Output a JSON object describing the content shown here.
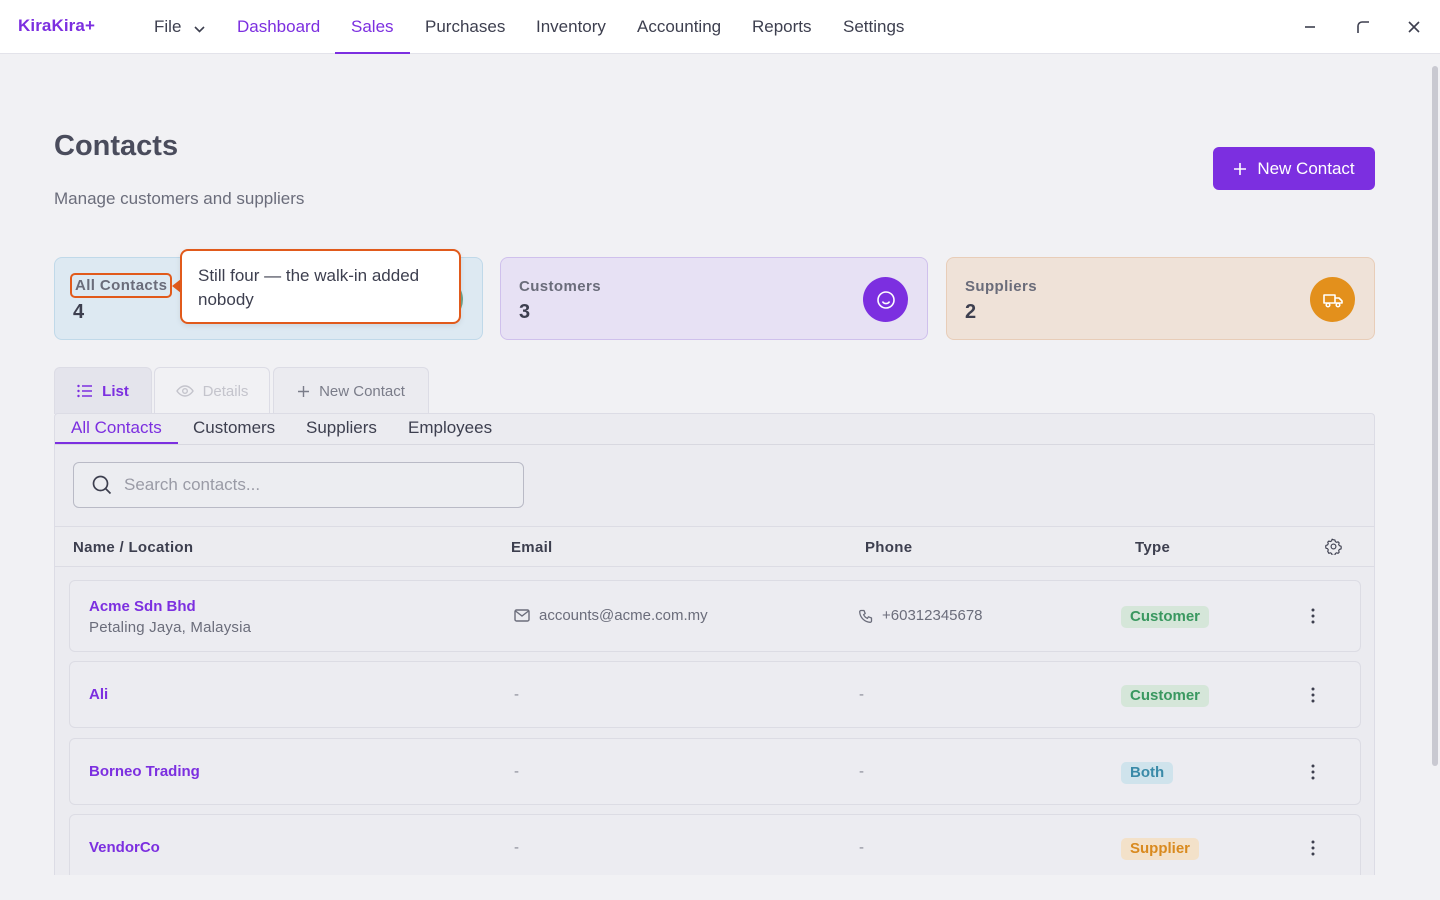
{
  "app": {
    "brand": "KiraKira+",
    "menu": [
      "File",
      "Dashboard",
      "Sales",
      "Purchases",
      "Inventory",
      "Accounting",
      "Reports",
      "Settings"
    ],
    "active_menu": "Sales"
  },
  "page": {
    "title": "Contacts",
    "subtitle": "Manage customers and suppliers",
    "new_contact_button": "New Contact"
  },
  "stats": [
    {
      "label": "All Contacts",
      "value": "4",
      "icon": "users-icon"
    },
    {
      "label": "Customers",
      "value": "3",
      "icon": "smile-icon",
      "color": "#7c2fe0"
    },
    {
      "label": "Suppliers",
      "value": "2",
      "icon": "truck-icon",
      "color": "#e3901c"
    }
  ],
  "callout": {
    "text": "Still four — the walk-in added nobody"
  },
  "view_tabs": [
    "List",
    "Details",
    "New Contact"
  ],
  "sub_tabs": [
    "All Contacts",
    "Customers",
    "Suppliers",
    "Employees"
  ],
  "search": {
    "placeholder": "Search contacts...",
    "value": ""
  },
  "table": {
    "columns": [
      "Name / Location",
      "Email",
      "Phone",
      "Type"
    ],
    "rows": [
      {
        "name": "Acme Sdn Bhd",
        "location": "Petaling Jaya, Malaysia",
        "email": "accounts@acme.com.my",
        "phone": "+60312345678",
        "type": "Customer"
      },
      {
        "name": "Ali",
        "location": "",
        "email": "-",
        "phone": "-",
        "type": "Customer"
      },
      {
        "name": "Borneo Trading",
        "location": "",
        "email": "-",
        "phone": "-",
        "type": "Both"
      },
      {
        "name": "VendorCo",
        "location": "",
        "email": "-",
        "phone": "-",
        "type": "Supplier"
      }
    ]
  },
  "colors": {
    "accent": "#7c2fe0",
    "highlight": "#e15a1b"
  }
}
